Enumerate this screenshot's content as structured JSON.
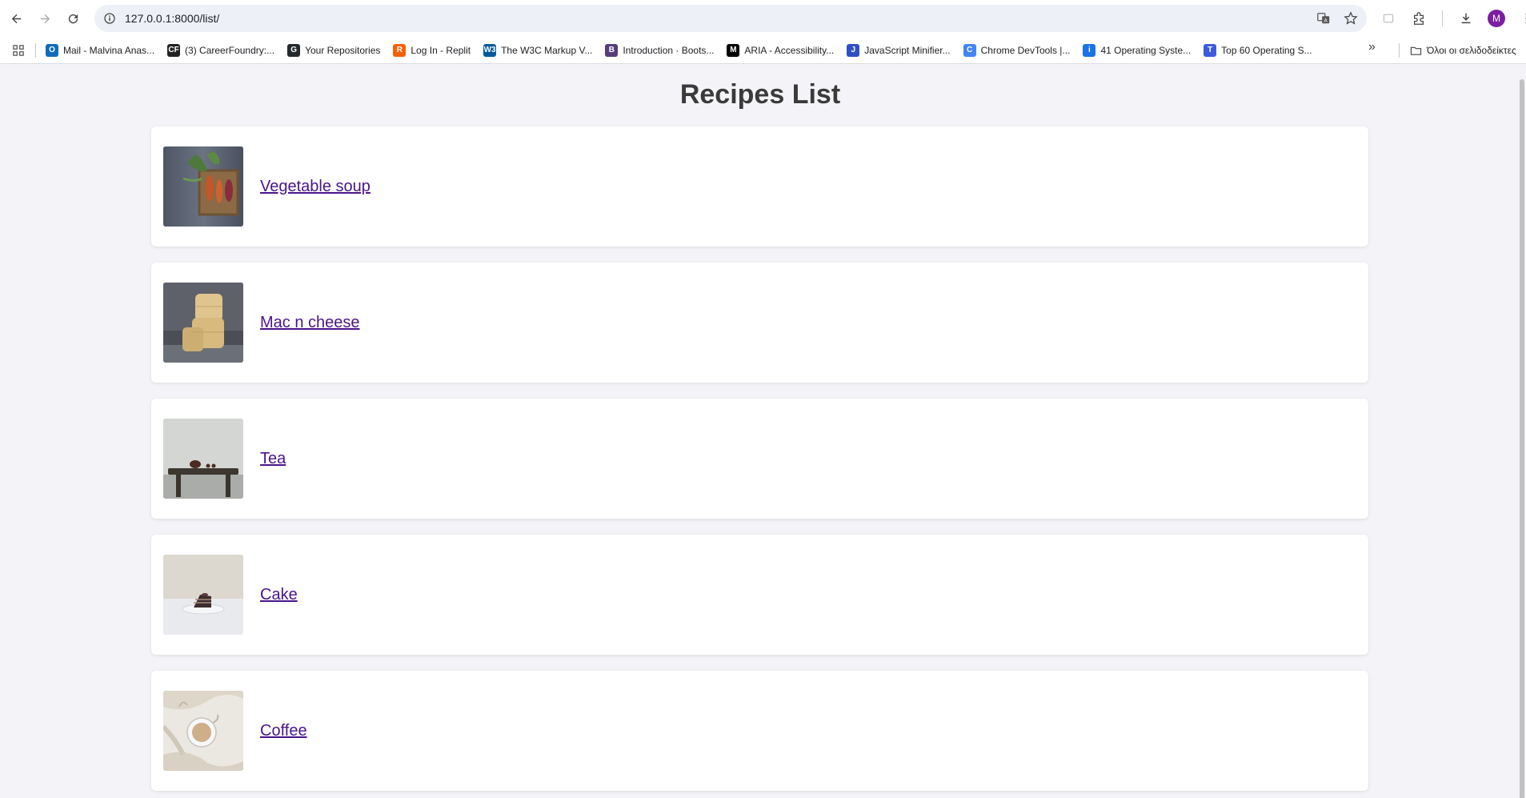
{
  "browser": {
    "url": "127.0.0.1:8000/list/",
    "avatar_letter": "M",
    "bookmarks": [
      {
        "label": "Mail - Malvina Anas...",
        "icon": "outlook-icon",
        "color": "#0f6cbd",
        "glyph": "O"
      },
      {
        "label": "(3) CareerFoundry:...",
        "icon": "careerfoundry-icon",
        "color": "#222222",
        "glyph": "CF"
      },
      {
        "label": "Your Repositories",
        "icon": "github-icon",
        "color": "#24292e",
        "glyph": "G"
      },
      {
        "label": "Log In - Replit",
        "icon": "replit-icon",
        "color": "#f26207",
        "glyph": "R"
      },
      {
        "label": "The W3C Markup V...",
        "icon": "w3c-icon",
        "color": "#005a9c",
        "glyph": "W3"
      },
      {
        "label": "Introduction · Boots...",
        "icon": "bootstrap-icon",
        "color": "#563d7c",
        "glyph": "B"
      },
      {
        "label": "ARIA - Accessibility...",
        "icon": "mdn-icon",
        "color": "#000000",
        "glyph": "M"
      },
      {
        "label": "JavaScript Minifier...",
        "icon": "minifier-icon",
        "color": "#2f4fc4",
        "glyph": "J"
      },
      {
        "label": "Chrome DevTools |...",
        "icon": "chrome-icon",
        "color": "#4285f4",
        "glyph": "C"
      },
      {
        "label": "41 Operating Syste...",
        "icon": "info-site-icon",
        "color": "#1a73e8",
        "glyph": "i"
      },
      {
        "label": "Top 60 Operating S...",
        "icon": "globe-icon",
        "color": "#3b5bdb",
        "glyph": "T"
      }
    ],
    "bookmarks_folder": "Όλοι οι σελιδοδείκτες"
  },
  "page": {
    "title": "Recipes List",
    "recipes": [
      {
        "name": "Vegetable soup",
        "image": "vegetables-basket-photo"
      },
      {
        "name": "Mac n cheese",
        "image": "cheese-wheels-photo"
      },
      {
        "name": "Tea",
        "image": "teapot-on-stool-photo"
      },
      {
        "name": "Cake",
        "image": "cake-slice-photo"
      },
      {
        "name": "Coffee",
        "image": "coffee-cup-photo"
      }
    ]
  },
  "colors": {
    "page_background": "#f4f4f8",
    "link": "#4a148c",
    "title": "#3a3a3a"
  }
}
